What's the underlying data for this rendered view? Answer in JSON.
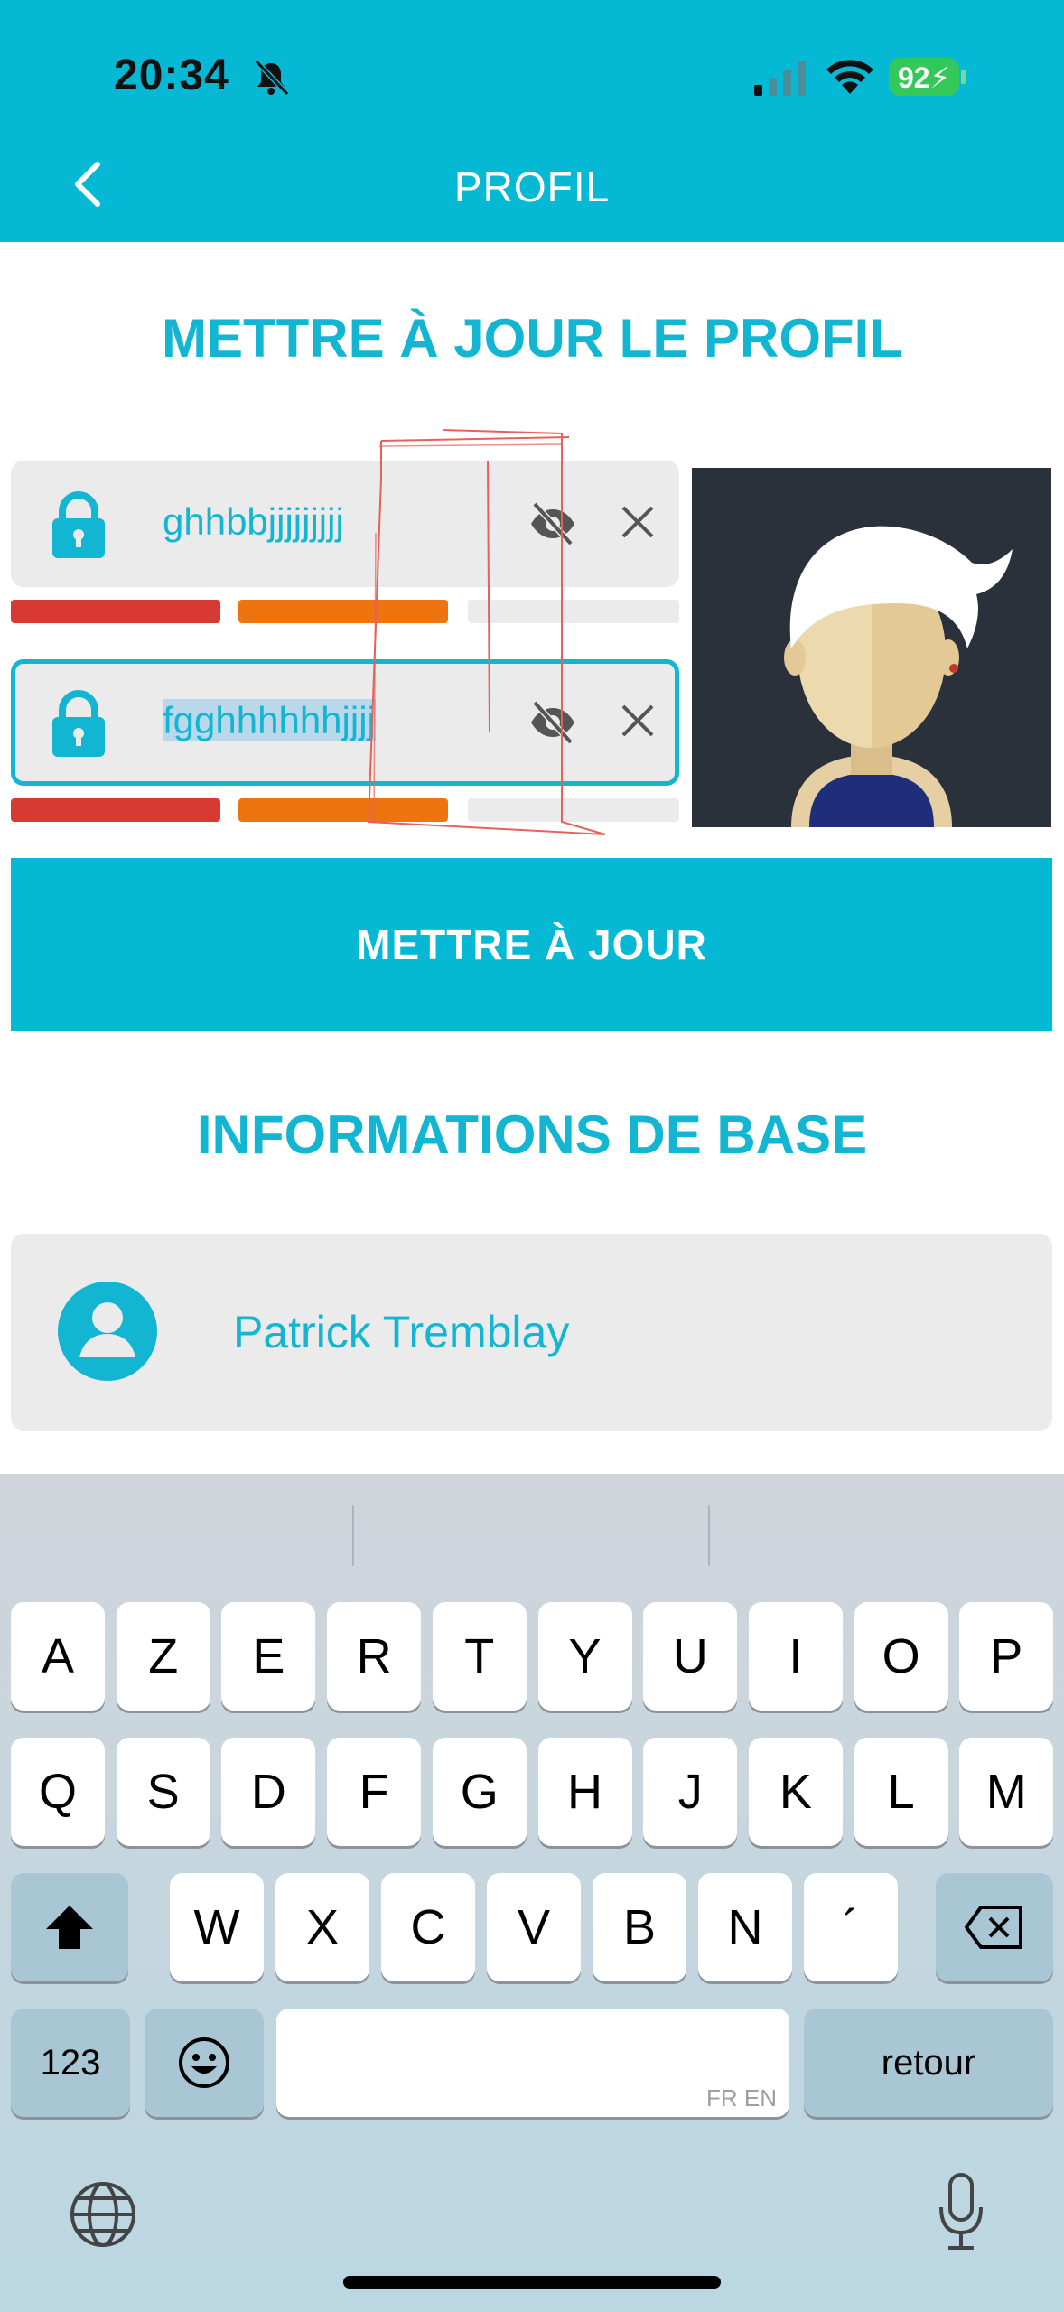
{
  "status_bar": {
    "time": "20:34",
    "battery": "92"
  },
  "header": {
    "title": "PROFIL"
  },
  "update_section": {
    "title": "METTRE À JOUR LE PROFIL",
    "password_field_1": {
      "value": "ghhbbjjjjjjjjj",
      "strength_segments_filled": 2,
      "strength_segments_total": 3
    },
    "password_field_2": {
      "value": "fgghhhhhhjjjj",
      "strength_segments_filled": 2,
      "strength_segments_total": 3
    },
    "update_button": "METTRE À JOUR"
  },
  "basic_info": {
    "title": "INFORMATIONS DE BASE",
    "name": "Patrick Tremblay"
  },
  "keyboard": {
    "row1": [
      "A",
      "Z",
      "E",
      "R",
      "T",
      "Y",
      "U",
      "I",
      "O",
      "P"
    ],
    "row2": [
      "Q",
      "S",
      "D",
      "F",
      "G",
      "H",
      "J",
      "K",
      "L",
      "M"
    ],
    "row3": [
      "W",
      "X",
      "C",
      "V",
      "B",
      "N",
      "´"
    ],
    "numbers_key": "123",
    "space_sub_label": "FR EN",
    "return_key": "retour"
  },
  "colors": {
    "accent": "#05b9d5",
    "weak": "#d63a32",
    "medium": "#ef7410",
    "annotation": "#e8605a"
  }
}
